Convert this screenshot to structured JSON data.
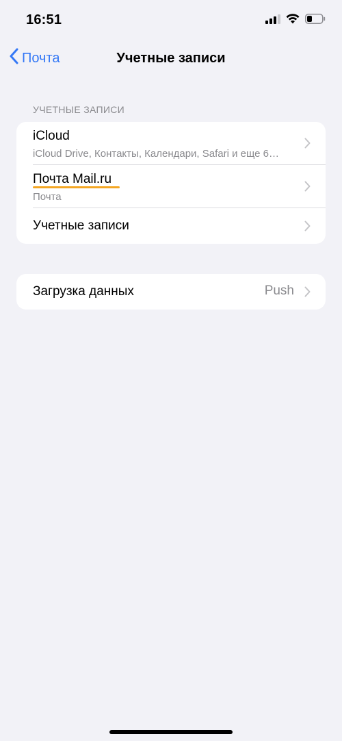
{
  "status_bar": {
    "time": "16:51",
    "icons": [
      "cellular-signal-icon",
      "wifi-icon",
      "battery-icon"
    ]
  },
  "nav": {
    "back_label": "Почта",
    "title": "Учетные записи"
  },
  "accounts_section": {
    "header": "УЧЕТНЫЕ ЗАПИСИ",
    "items": [
      {
        "title": "iCloud",
        "subtitle": "iCloud Drive, Контакты, Календари, Safari и еще 6…"
      },
      {
        "title": "Почта Mail.ru",
        "subtitle": "Почта"
      },
      {
        "title": "Учетные записи",
        "subtitle": ""
      }
    ]
  },
  "fetch_section": {
    "title": "Загрузка данных",
    "value": "Push"
  },
  "colors": {
    "accent": "#3478f6",
    "background": "#f2f2f7",
    "secondary_text": "#8a8a8e",
    "highlight": "#f4a623"
  }
}
